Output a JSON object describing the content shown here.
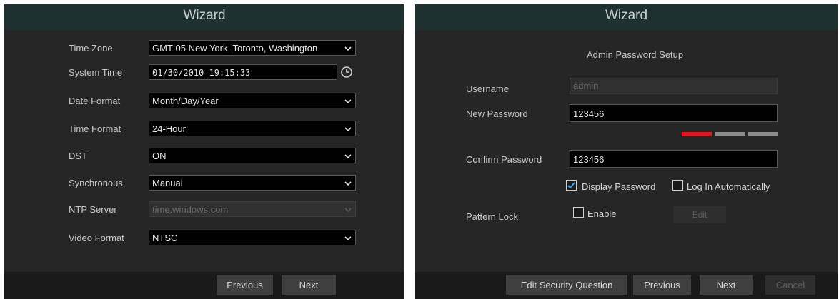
{
  "left": {
    "title": "Wizard",
    "fields": {
      "time_zone": {
        "label": "Time Zone",
        "value": "GMT-05 New York, Toronto, Washington"
      },
      "system_time": {
        "label": "System Time",
        "value": "01/30/2010 19:15:33"
      },
      "date_format": {
        "label": "Date Format",
        "value": "Month/Day/Year"
      },
      "time_format": {
        "label": "Time Format",
        "value": "24-Hour"
      },
      "dst": {
        "label": "DST",
        "value": "ON"
      },
      "synchronous": {
        "label": "Synchronous",
        "value": "Manual"
      },
      "ntp_server": {
        "label": "NTP Server",
        "value": "time.windows.com"
      },
      "video_format": {
        "label": "Video Format",
        "value": "NTSC"
      }
    },
    "buttons": {
      "previous": "Previous",
      "next": "Next"
    }
  },
  "right": {
    "title": "Wizard",
    "subtitle": "Admin Password Setup",
    "username": {
      "label": "Username",
      "value": "admin"
    },
    "new_password": {
      "label": "New Password",
      "value": "123456"
    },
    "password_strength": {
      "level": 1,
      "max": 3,
      "active_color": "#e8141c",
      "inactive_color": "#8c8c8c"
    },
    "confirm_password": {
      "label": "Confirm Password",
      "value": "123456"
    },
    "display_password": {
      "label": "Display Password",
      "checked": true
    },
    "log_in_automatically": {
      "label": "Log In Automatically",
      "checked": false
    },
    "pattern_lock": {
      "label": "Pattern Lock",
      "enable_label": "Enable",
      "checked": false,
      "edit_label": "Edit"
    },
    "buttons": {
      "edit_security_question": "Edit Security Question",
      "previous": "Previous",
      "next": "Next",
      "cancel": "Cancel"
    }
  },
  "colors": {
    "title_bar": "#1f3030",
    "panel": "#262626",
    "check_accent": "#3a9ff5"
  }
}
